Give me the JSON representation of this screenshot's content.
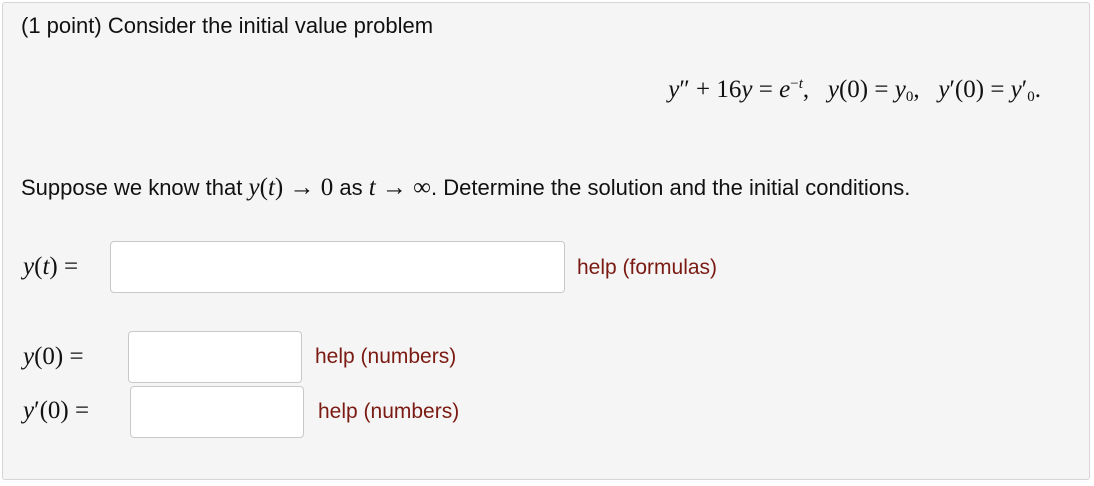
{
  "problem": {
    "intro": "(1 point) Consider the initial value problem",
    "condition_prefix": "Suppose we know that",
    "condition_as": "as",
    "condition_suffix": ". Determine the solution and the initial conditions."
  },
  "fields": {
    "y_t": {
      "value": "",
      "help_label": "help (formulas)"
    },
    "y0": {
      "value": "",
      "help_label": "help (numbers)"
    },
    "yp0": {
      "value": "",
      "help_label": "help (numbers)"
    }
  },
  "colors": {
    "help_link": "#7a1a12",
    "panel_bg": "#f5f5f5",
    "input_border": "#c8c8c8"
  }
}
